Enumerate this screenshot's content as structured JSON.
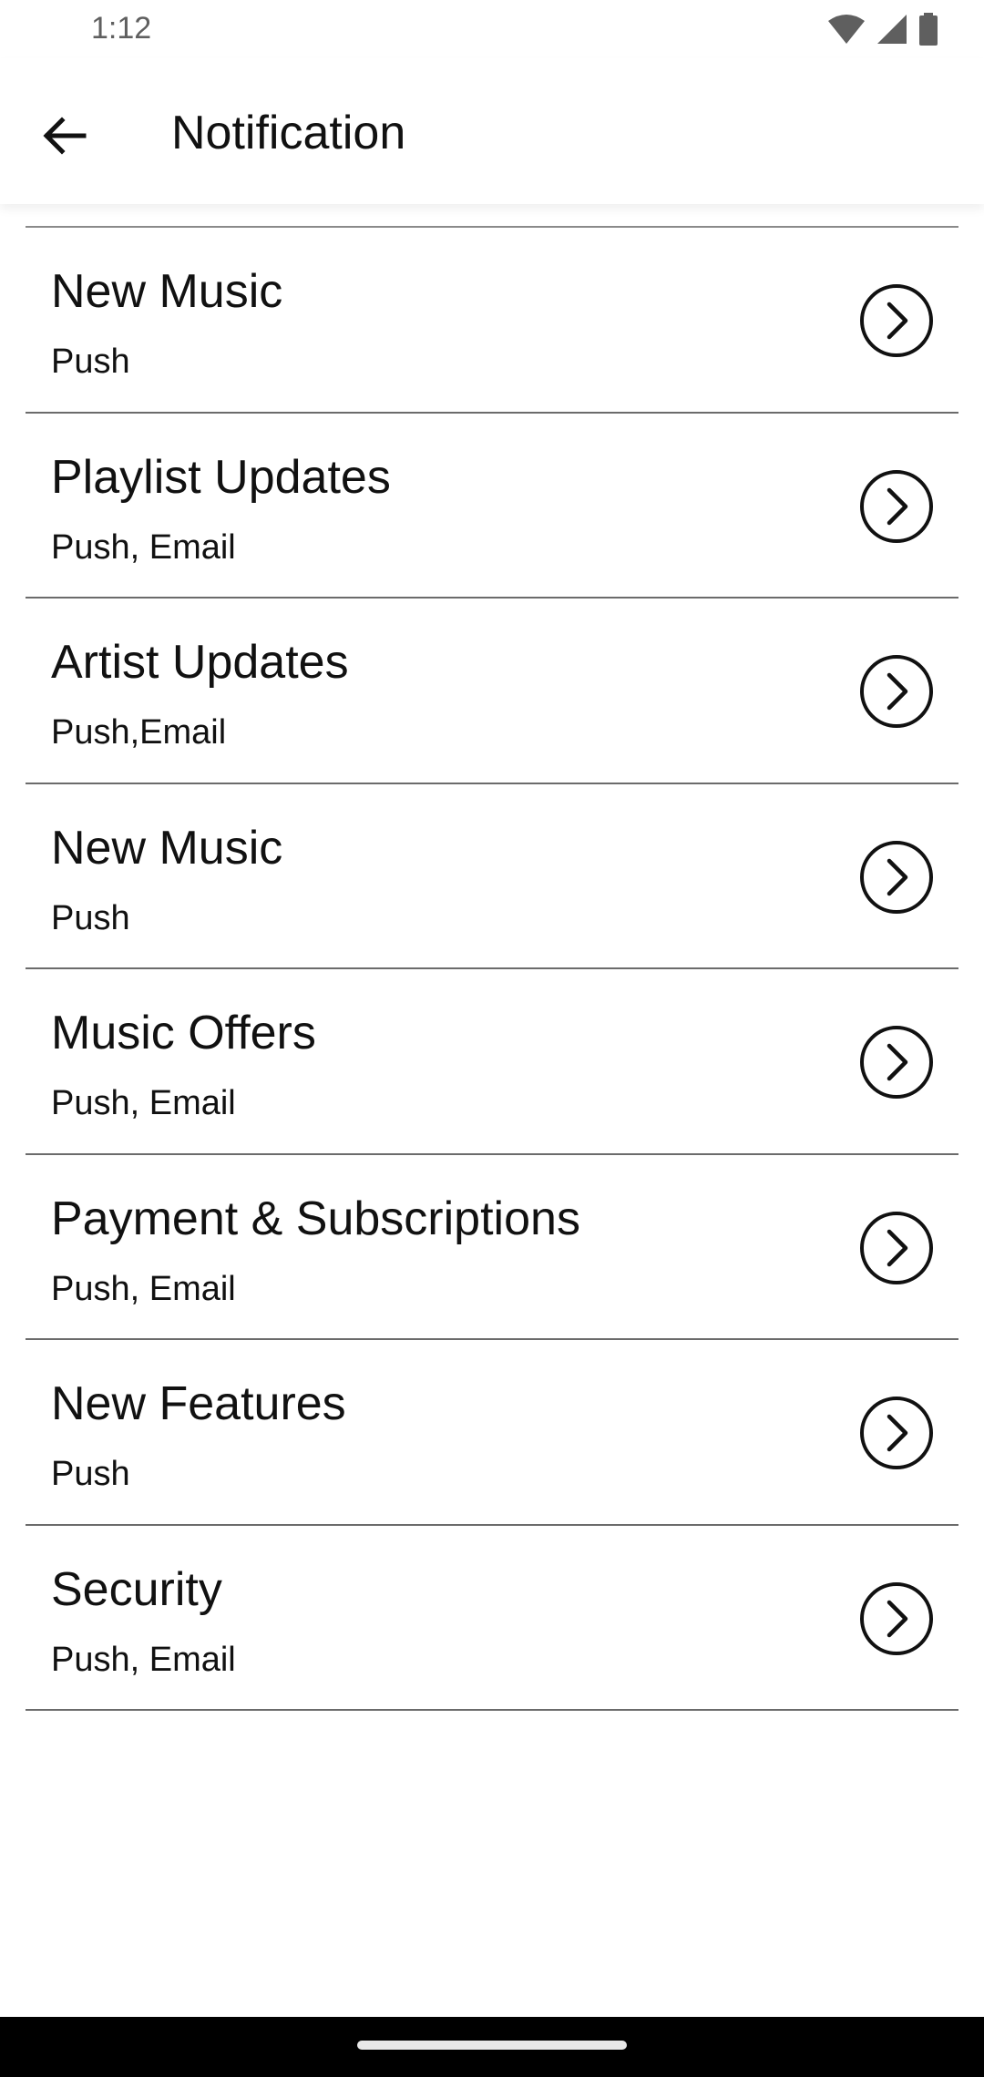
{
  "status_bar": {
    "time": "1:12",
    "icons": [
      "wifi-icon",
      "cellular-signal-icon",
      "battery-icon"
    ]
  },
  "app_bar": {
    "title": "Notification",
    "back_icon": "arrow-left-icon"
  },
  "notifications": [
    {
      "title": "New Music",
      "channels": "Push"
    },
    {
      "title": "Playlist Updates",
      "channels": "Push, Email"
    },
    {
      "title": "Artist Updates",
      "channels": "Push,Email"
    },
    {
      "title": "New Music",
      "channels": "Push"
    },
    {
      "title": "Music Offers",
      "channels": "Push, Email"
    },
    {
      "title": "Payment & Subscriptions",
      "channels": "Push, Email"
    },
    {
      "title": "New Features",
      "channels": "Push"
    },
    {
      "title": "Security",
      "channels": "Push, Email"
    }
  ],
  "colors": {
    "text": "#111111",
    "divider": "#6b6b6b",
    "nav_bar": "#000000"
  }
}
